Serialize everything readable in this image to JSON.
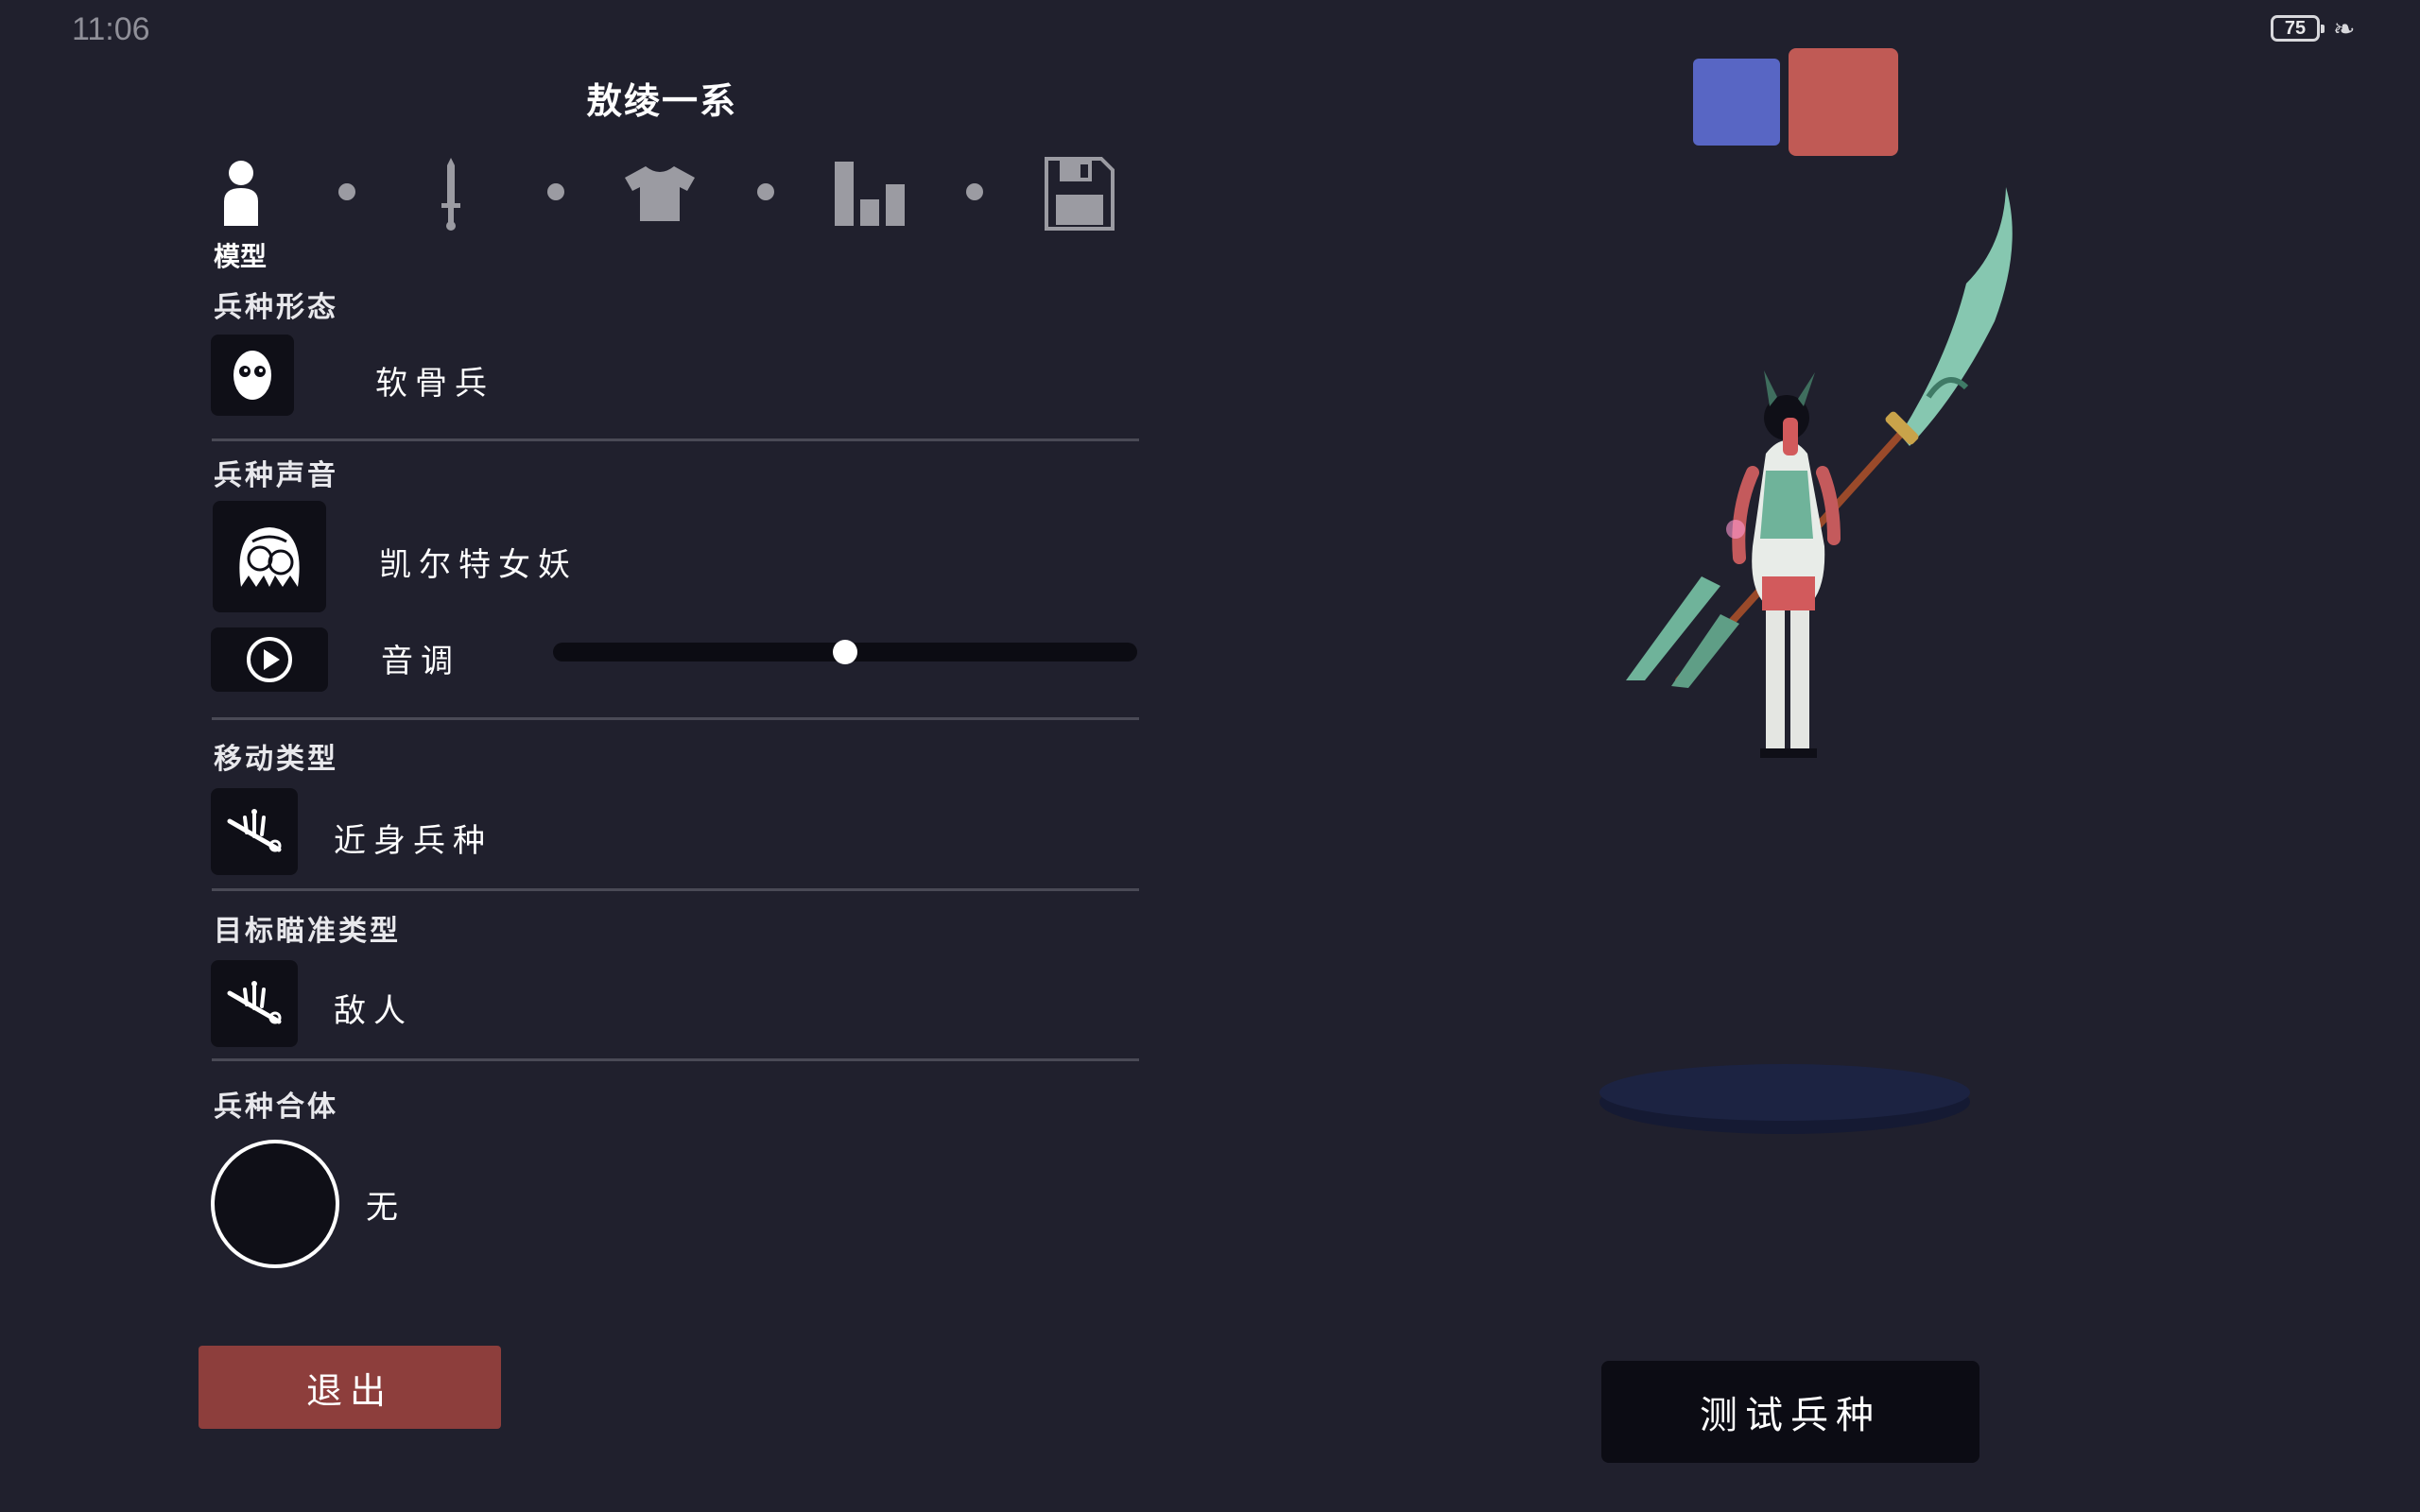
{
  "status_bar": {
    "time": "11:06",
    "battery": "75"
  },
  "title": "敖绫一系",
  "nav": {
    "steps": [
      {
        "icon": "person-icon",
        "label": "模型",
        "active": true
      },
      {
        "icon": "sword-icon"
      },
      {
        "icon": "shirt-icon"
      },
      {
        "icon": "bar-chart-icon"
      },
      {
        "icon": "save-icon"
      }
    ]
  },
  "sections": {
    "form": {
      "heading": "兵种形态",
      "value": "软骨兵",
      "icon": "ragdoll-face-icon"
    },
    "voice": {
      "heading": "兵种声音",
      "value": "凯尔特女妖",
      "icon": "banshee-icon",
      "play_icon": "play-icon",
      "pitch_label": "音调",
      "pitch": 0.5
    },
    "movement": {
      "heading": "移动类型",
      "value": "近身兵种",
      "icon": "movement-icon"
    },
    "targeting": {
      "heading": "目标瞄准类型",
      "value": "敌人",
      "icon": "target-icon"
    },
    "merge": {
      "heading": "兵种合体",
      "value": "无"
    }
  },
  "buttons": {
    "exit": "退出",
    "test_unit": "测试兵种"
  },
  "colors": {
    "background": "#20202d",
    "team_blue": "#5866c4",
    "team_red": "#c05a55",
    "exit_button": "#8d3e3c"
  }
}
